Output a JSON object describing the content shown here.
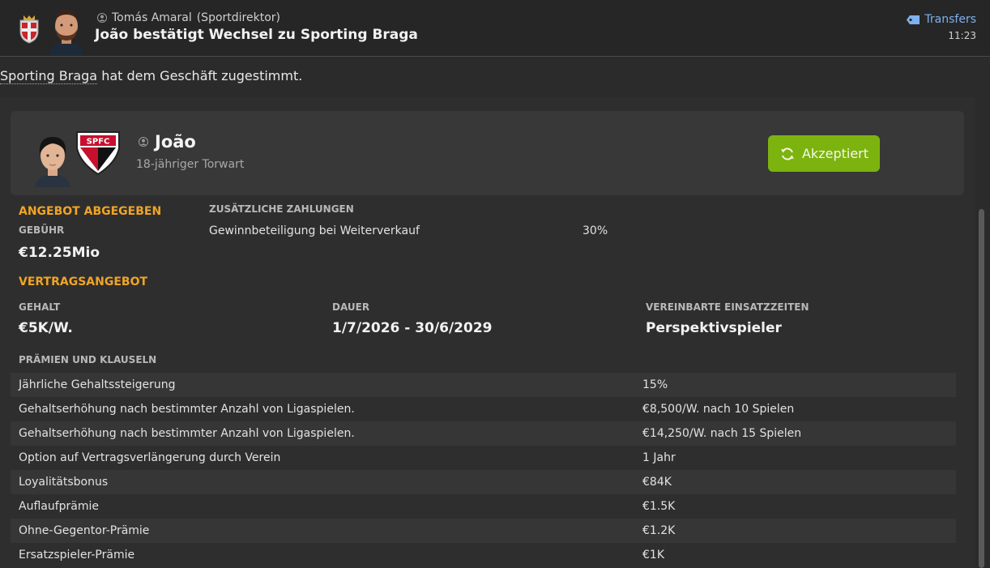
{
  "header": {
    "sender_name": "Tomás Amaral",
    "sender_role": "(Sportdirektor)",
    "subject": "João bestätigt Wechsel zu Sporting Braga",
    "link_label": "Transfers",
    "time": "11:23"
  },
  "intro": {
    "club_link": "Sporting Braga",
    "text": " hat dem Geschäft zugestimmt."
  },
  "player": {
    "name": "João",
    "description": "18-jähriger Torwart",
    "crest_text": "SPFC",
    "status_label": "Akzeptiert"
  },
  "offer": {
    "section_title": "ANGEBOT ABGEGEBEN",
    "fee_label": "GEBÜHR",
    "fee_value": "€12.25Mio",
    "extra_label": "ZUSÄTZLICHE ZAHLUNGEN",
    "extra_name": "Gewinnbeteiligung bei Weiterverkauf",
    "extra_value": "30%"
  },
  "contract": {
    "section_title": "VERTRAGSANGEBOT",
    "salary_label": "GEHALT",
    "salary_value": "€5K/W.",
    "duration_label": "DAUER",
    "duration_value": "1/7/2026 - 30/6/2029",
    "playing_time_label": "VEREINBARTE EINSATZZEITEN",
    "playing_time_value": "Perspektivspieler",
    "clauses_label": "PRÄMIEN UND KLAUSELN"
  },
  "clauses": [
    {
      "name": "Jährliche Gehaltssteigerung",
      "value": "15%"
    },
    {
      "name": "Gehaltserhöhung nach bestimmter Anzahl von Ligaspielen.",
      "value": "€8,500/W. nach 10 Spielen"
    },
    {
      "name": "Gehaltserhöhung nach bestimmter Anzahl von Ligaspielen.",
      "value": "€14,250/W. nach 15 Spielen"
    },
    {
      "name": "Option auf Vertragsverlängerung durch Verein",
      "value": "1 Jahr"
    },
    {
      "name": "Loyalitätsbonus",
      "value": "€84K"
    },
    {
      "name": "Auflaufprämie",
      "value": "€1.5K"
    },
    {
      "name": "Ohne-Gegentor-Prämie",
      "value": "€1.2K"
    },
    {
      "name": "Ersatzspieler-Prämie",
      "value": "€1K"
    }
  ],
  "colors": {
    "accent_orange": "#f0a426",
    "accept_green": "#7db30f",
    "link_blue": "#7fb0f0"
  }
}
